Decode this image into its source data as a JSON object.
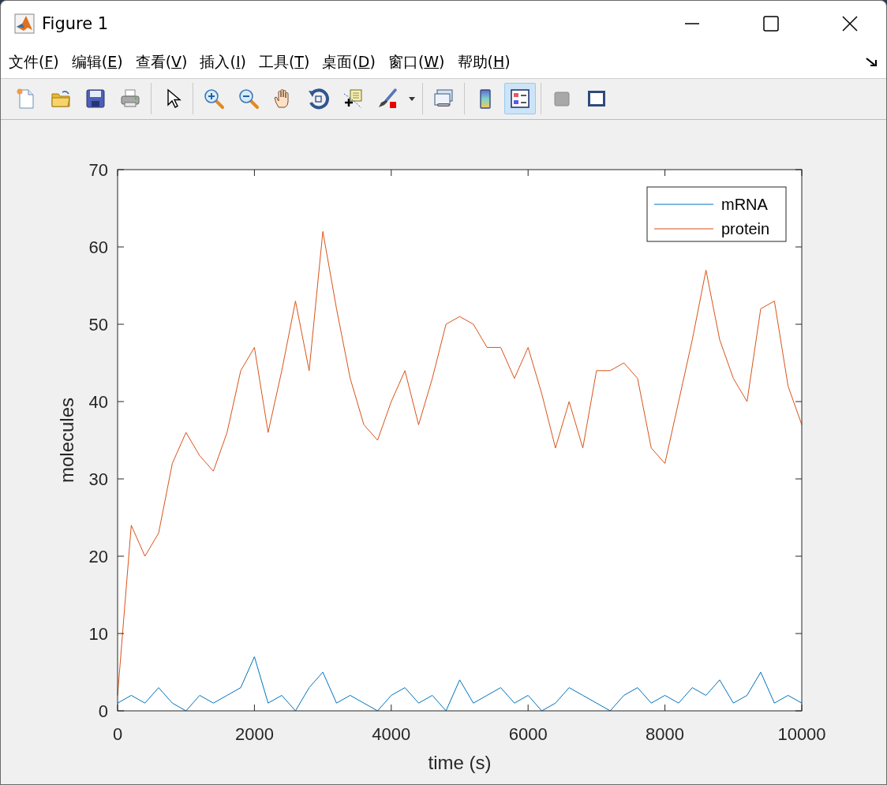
{
  "window": {
    "title": "Figure 1"
  },
  "menu": [
    {
      "before": "文件(",
      "mnemonic": "F",
      "after": ")"
    },
    {
      "before": "编辑(",
      "mnemonic": "E",
      "after": ")"
    },
    {
      "before": "查看(",
      "mnemonic": "V",
      "after": ")"
    },
    {
      "before": "插入(",
      "mnemonic": "I",
      "after": ")"
    },
    {
      "before": "工具(",
      "mnemonic": "T",
      "after": ")"
    },
    {
      "before": "桌面(",
      "mnemonic": "D",
      "after": ")"
    },
    {
      "before": "窗口(",
      "mnemonic": "W",
      "after": ")"
    },
    {
      "before": "帮助(",
      "mnemonic": "H",
      "after": ")"
    }
  ],
  "toolbar": {
    "groups": [
      [
        {
          "kind": "new",
          "selected": false
        },
        {
          "kind": "open",
          "selected": false
        },
        {
          "kind": "save",
          "selected": false
        },
        {
          "kind": "print",
          "selected": false
        }
      ],
      [
        {
          "kind": "pointer",
          "selected": false
        }
      ],
      [
        {
          "kind": "zoom_in",
          "selected": false
        },
        {
          "kind": "zoom_out",
          "selected": false
        },
        {
          "kind": "pan",
          "selected": false
        },
        {
          "kind": "rotate",
          "selected": false
        },
        {
          "kind": "datatip",
          "selected": false
        },
        {
          "kind": "brush",
          "selected": false
        },
        {
          "kind": "dropdown",
          "selected": false
        }
      ],
      [
        {
          "kind": "link",
          "selected": false
        }
      ],
      [
        {
          "kind": "colorbar",
          "selected": false
        },
        {
          "kind": "legend",
          "selected": true
        }
      ],
      [
        {
          "kind": "hide_tools",
          "selected": false
        },
        {
          "kind": "show_tools",
          "selected": false
        }
      ]
    ]
  },
  "figure": {
    "chart_data": {
      "type": "line",
      "xlabel": "time (s)",
      "ylabel": "molecules",
      "x": [
        0,
        200,
        400,
        600,
        800,
        1000,
        1200,
        1400,
        1600,
        1800,
        2000,
        2200,
        2400,
        2600,
        2800,
        3000,
        3200,
        3400,
        3600,
        3800,
        4000,
        4200,
        4400,
        4600,
        4800,
        5000,
        5200,
        5400,
        5600,
        5800,
        6000,
        6200,
        6400,
        6600,
        6800,
        7000,
        7200,
        7400,
        7600,
        7800,
        8000,
        8200,
        8400,
        8600,
        8800,
        9000,
        9200,
        9400,
        9600,
        9800,
        10000
      ],
      "series": [
        {
          "name": "mRNA",
          "color": "#0072bd",
          "values": [
            1,
            2,
            1,
            3,
            1,
            0,
            2,
            1,
            2,
            3,
            7,
            1,
            2,
            0,
            3,
            5,
            1,
            2,
            1,
            0,
            2,
            3,
            1,
            2,
            0,
            4,
            1,
            2,
            3,
            1,
            2,
            0,
            1,
            3,
            2,
            1,
            0,
            2,
            3,
            1,
            2,
            1,
            3,
            2,
            4,
            1,
            2,
            5,
            1,
            2,
            1
          ]
        },
        {
          "name": "protein",
          "color": "#d95319",
          "values": [
            2,
            24,
            20,
            23,
            32,
            36,
            33,
            31,
            36,
            44,
            47,
            36,
            44,
            53,
            44,
            62,
            52,
            43,
            37,
            35,
            40,
            44,
            37,
            43,
            50,
            51,
            50,
            47,
            47,
            43,
            47,
            41,
            34,
            40,
            34,
            44,
            44,
            45,
            43,
            34,
            32,
            40,
            48,
            57,
            48,
            43,
            40,
            52,
            53,
            42,
            37
          ]
        }
      ],
      "legend": true,
      "xlim": [
        0,
        10000
      ],
      "ylim": [
        0,
        70
      ],
      "xticks": [
        0,
        2000,
        4000,
        6000,
        8000,
        10000
      ],
      "yticks": [
        0,
        10,
        20,
        30,
        40,
        50,
        60,
        70
      ]
    }
  }
}
